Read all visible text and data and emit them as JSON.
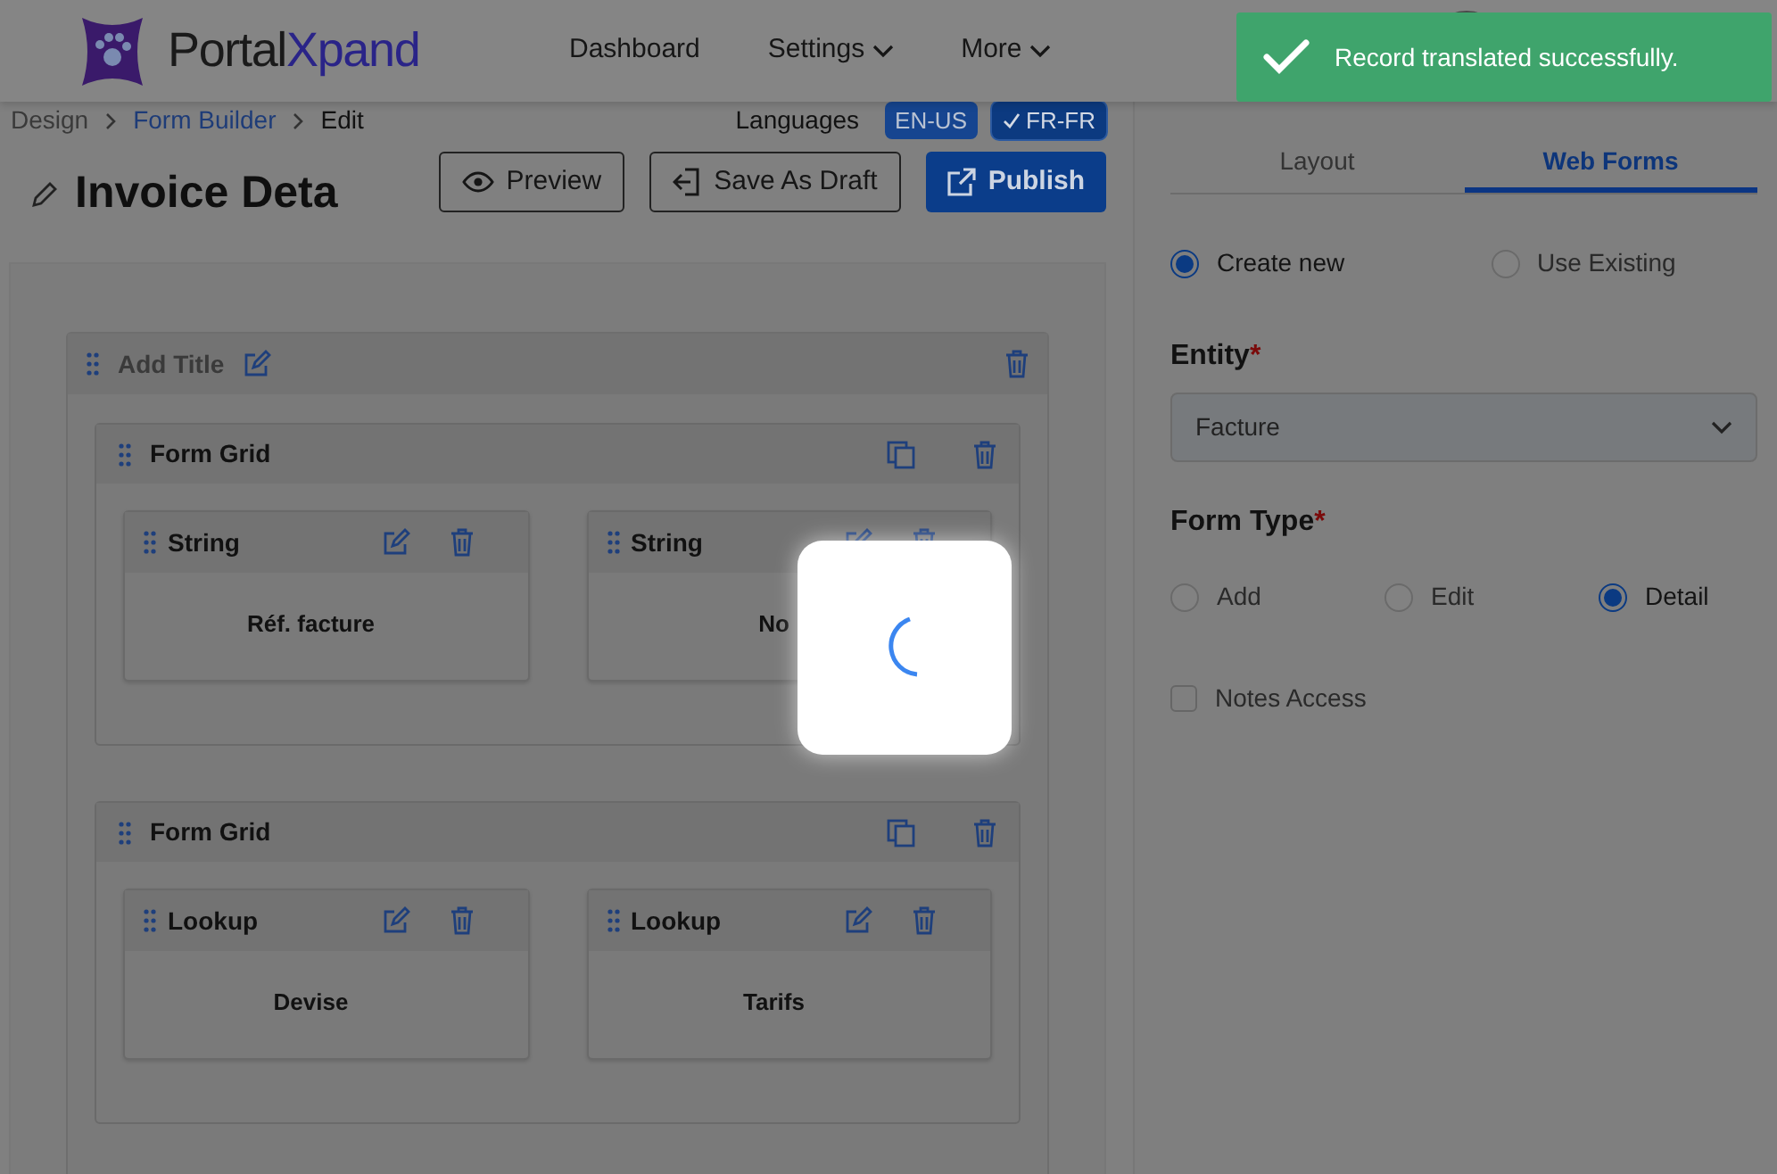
{
  "header": {
    "brand_parts": [
      "Portal",
      "Xpand"
    ],
    "nav": [
      {
        "label": "Dashboard",
        "dropdown": false
      },
      {
        "label": "Settings",
        "dropdown": true
      },
      {
        "label": "More",
        "dropdown": true
      }
    ]
  },
  "toast": {
    "message": "Record translated successfully."
  },
  "loading": true,
  "breadcrumb": [
    {
      "label": "Design",
      "kind": "muted"
    },
    {
      "label": "Form Builder",
      "kind": "link"
    },
    {
      "label": "Edit",
      "kind": "current"
    }
  ],
  "languages": {
    "label": "Languages",
    "items": [
      {
        "code": "EN-US",
        "selected": false
      },
      {
        "code": "FR-FR",
        "selected": true
      }
    ]
  },
  "title": "Invoice Deta",
  "actions": [
    {
      "label": "Preview",
      "kind": "outline"
    },
    {
      "label": "Save As Draft",
      "kind": "outline"
    },
    {
      "label": "Publish",
      "kind": "primary"
    }
  ],
  "canvas": {
    "section_title": "Add Title",
    "grids": [
      {
        "title": "Form Grid",
        "fields": [
          {
            "type": "String",
            "label": "Réf. facture"
          },
          {
            "type": "String",
            "label": "No"
          }
        ]
      },
      {
        "title": "Form Grid",
        "fields": [
          {
            "type": "Lookup",
            "label": "Devise"
          },
          {
            "type": "Lookup",
            "label": "Tarifs"
          }
        ]
      }
    ]
  },
  "panel": {
    "tabs": [
      {
        "label": "Layout",
        "selected": false
      },
      {
        "label": "Web Forms",
        "selected": true
      }
    ],
    "source_options": [
      {
        "label": "Create new",
        "selected": true
      },
      {
        "label": "Use Existing",
        "selected": false
      }
    ],
    "entity": {
      "label": "Entity",
      "required_mark": "*",
      "value": "Facture"
    },
    "form_type": {
      "label": "Form Type",
      "required_mark": "*",
      "options": [
        {
          "label": "Add",
          "selected": false
        },
        {
          "label": "Edit",
          "selected": false
        },
        {
          "label": "Detail",
          "selected": true
        }
      ]
    },
    "notes_access": {
      "label": "Notes Access",
      "checked": false
    }
  }
}
